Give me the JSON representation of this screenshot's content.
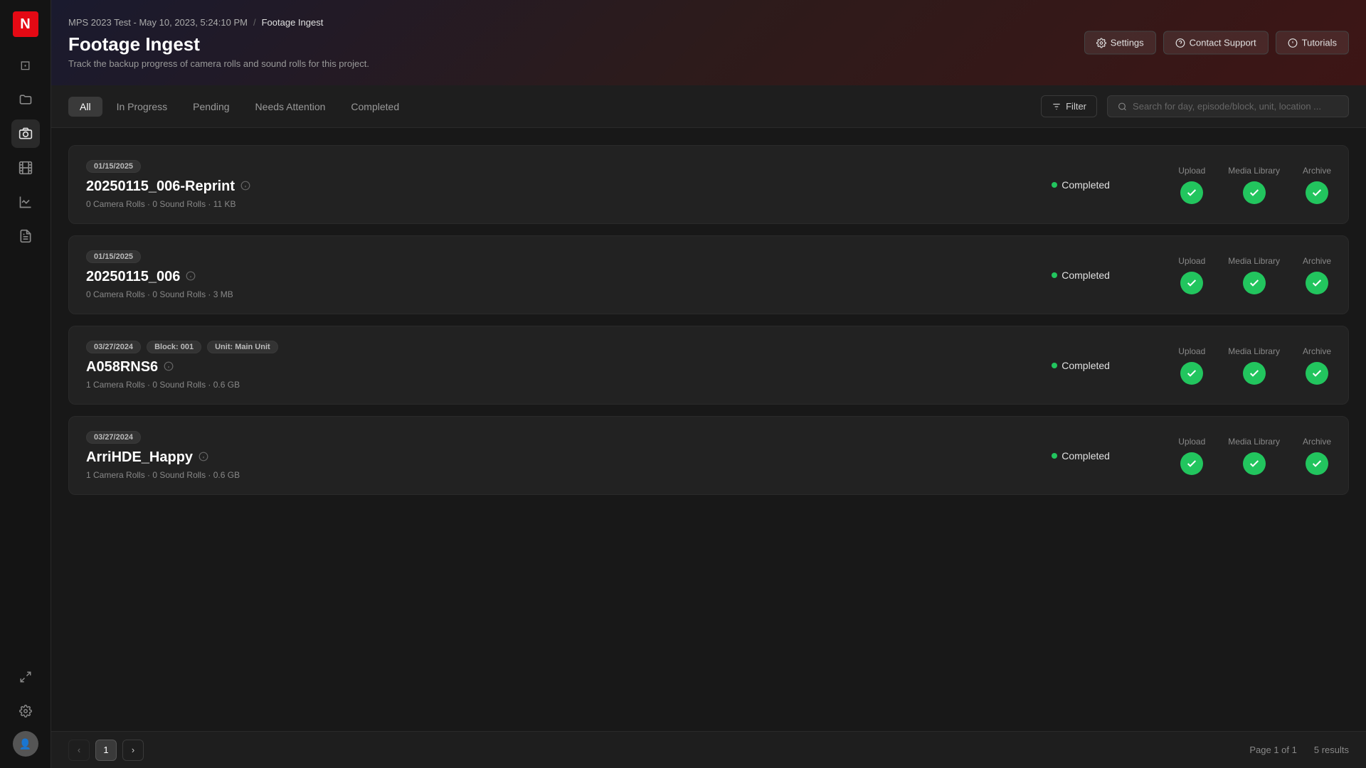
{
  "sidebar": {
    "logo": "N",
    "icons": [
      {
        "name": "monitor-icon",
        "symbol": "⊡",
        "active": false
      },
      {
        "name": "folder-icon",
        "symbol": "⊟",
        "active": false
      },
      {
        "name": "camera-icon",
        "symbol": "⊞",
        "active": true
      },
      {
        "name": "film-icon",
        "symbol": "⊠",
        "active": false
      },
      {
        "name": "chart-icon",
        "symbol": "⊕",
        "active": false
      },
      {
        "name": "panel-icon",
        "symbol": "⊗",
        "active": false
      }
    ],
    "settings_icon": "⚙",
    "expand_icon": "⟺"
  },
  "header": {
    "breadcrumb_project": "MPS 2023 Test - May 10, 2023, 5:24:10 PM",
    "breadcrumb_separator": "/",
    "breadcrumb_page": "Footage Ingest",
    "title": "Footage Ingest",
    "subtitle": "Track the backup progress of camera rolls and sound rolls for this project.",
    "buttons": {
      "settings": "Settings",
      "contact_support": "Contact Support",
      "tutorials": "Tutorials"
    }
  },
  "filters": {
    "tabs": [
      {
        "id": "all",
        "label": "All",
        "active": true
      },
      {
        "id": "in-progress",
        "label": "In Progress",
        "active": false
      },
      {
        "id": "pending",
        "label": "Pending",
        "active": false
      },
      {
        "id": "needs-attention",
        "label": "Needs Attention",
        "active": false
      },
      {
        "id": "completed",
        "label": "Completed",
        "active": false
      }
    ],
    "filter_btn": "Filter",
    "search_placeholder": "Search for day, episode/block, unit, location ..."
  },
  "cards": [
    {
      "id": "card-1",
      "tags": [
        {
          "label": "01/15/2025"
        }
      ],
      "name": "20250115_006-Reprint",
      "meta": "0  Camera Rolls  ·  0  Sound Rolls  ·  11 KB",
      "status": "Completed",
      "stages": [
        {
          "label": "Upload",
          "done": true
        },
        {
          "label": "Media Library",
          "done": true
        },
        {
          "label": "Archive",
          "done": true
        }
      ]
    },
    {
      "id": "card-2",
      "tags": [
        {
          "label": "01/15/2025"
        }
      ],
      "name": "20250115_006",
      "meta": "0  Camera Rolls  ·  0  Sound Rolls  ·  3 MB",
      "status": "Completed",
      "stages": [
        {
          "label": "Upload",
          "done": true
        },
        {
          "label": "Media Library",
          "done": true
        },
        {
          "label": "Archive",
          "done": true
        }
      ]
    },
    {
      "id": "card-3",
      "tags": [
        {
          "label": "03/27/2024"
        },
        {
          "label": "Block: 001"
        },
        {
          "label": "Unit: Main Unit"
        }
      ],
      "name": "A058RNS6",
      "meta": "1  Camera Rolls  ·  0  Sound Rolls  ·  0.6 GB",
      "status": "Completed",
      "stages": [
        {
          "label": "Upload",
          "done": true
        },
        {
          "label": "Media Library",
          "done": true
        },
        {
          "label": "Archive",
          "done": true
        }
      ]
    },
    {
      "id": "card-4",
      "tags": [
        {
          "label": "03/27/2024"
        }
      ],
      "name": "ArriHDE_Happy",
      "meta": "1  Camera Rolls  ·  0  Sound Rolls  ·  0.6 GB",
      "status": "Completed",
      "stages": [
        {
          "label": "Upload",
          "done": true
        },
        {
          "label": "Media Library",
          "done": true
        },
        {
          "label": "Archive",
          "done": true
        }
      ]
    }
  ],
  "footer": {
    "page_info": "Page 1 of 1",
    "results": "5 results",
    "current_page": 1
  }
}
